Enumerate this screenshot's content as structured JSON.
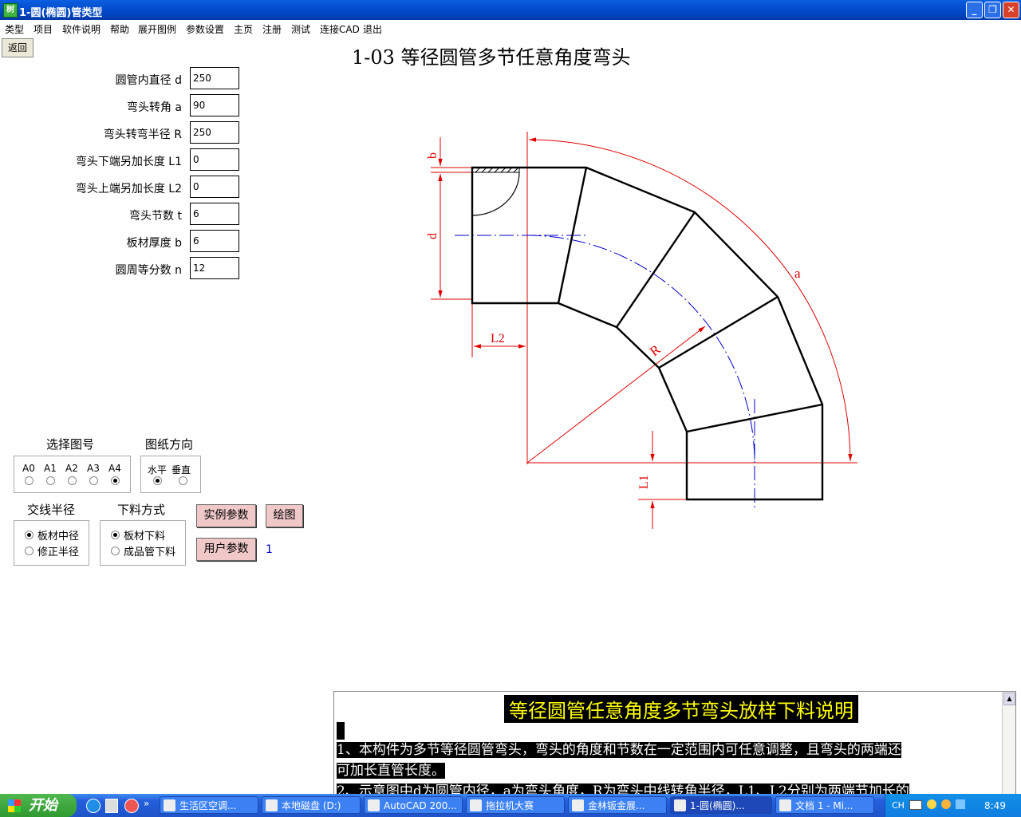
{
  "window": {
    "title": "1-圆(椭圆)管类型",
    "app_icon": "树",
    "minimize": "_",
    "restore": "❐",
    "close": "✕"
  },
  "menu": [
    "类型",
    "项目",
    "软件说明",
    "帮助",
    "展开图例",
    "参数设置",
    "主页",
    "注册",
    "测试",
    "连接CAD",
    "退出"
  ],
  "back_label": "返回",
  "page_title": "1-03  等径圆管多节任意角度弯头",
  "params": [
    {
      "label": "圆管内直径 d",
      "value": "250"
    },
    {
      "label": "弯头转角 a",
      "value": "90"
    },
    {
      "label": "弯头转弯半径 R",
      "value": "250"
    },
    {
      "label": "弯头下端另加长度 L1",
      "value": "0"
    },
    {
      "label": "弯头上端另加长度 L2",
      "value": "0"
    },
    {
      "label": "弯头节数 t",
      "value": "6"
    },
    {
      "label": "板材厚度 b",
      "value": "6"
    },
    {
      "label": "圆周等分数 n",
      "value": "12"
    }
  ],
  "paper": {
    "title": "选择图号",
    "options": [
      "A0",
      "A1",
      "A2",
      "A3",
      "A4"
    ],
    "selected": "A4"
  },
  "orient": {
    "title": "图纸方向",
    "options": [
      "水平",
      "垂直"
    ],
    "selected": "水平"
  },
  "radius": {
    "title": "交线半径",
    "options": [
      "板材中径",
      "修正半径"
    ],
    "selected": "板材中径"
  },
  "cut": {
    "title": "下料方式",
    "options": [
      "板材下料",
      "成品管下料"
    ],
    "selected": "板材下料"
  },
  "buttons": {
    "example": "实例参数",
    "draw": "绘图",
    "user": "用户参数",
    "user_count": "1"
  },
  "drawing": {
    "b": "b",
    "d": "d",
    "L2": "L2",
    "L1": "L1",
    "R": "R",
    "a": "a",
    "colors": {
      "dim": "#e00000",
      "center": "#0000cc"
    }
  },
  "doc": {
    "title": "等径圆管任意角度多节弯头放样下料说明",
    "line1": "    1、本构件为多节等径圆管弯头，弯头的角度和节数在一定范围内可任意调整，且弯头的两端还",
    "line2": "可加长直管长度。",
    "line3": "    2、示意图中d为圆管内径，a为弯头角度，R为弯头中线转角半径，L1、L2分别为两端节加长的"
  },
  "taskbar": {
    "start": "开始",
    "tasks": [
      "生活区空调...",
      "本地磁盘 (D:)",
      "AutoCAD 200...",
      "拖拉机大赛",
      "金林钣金展...",
      "1-圆(椭圆)...",
      "文档 1 - Mi..."
    ],
    "lang": "CH",
    "clock": "8:49"
  }
}
